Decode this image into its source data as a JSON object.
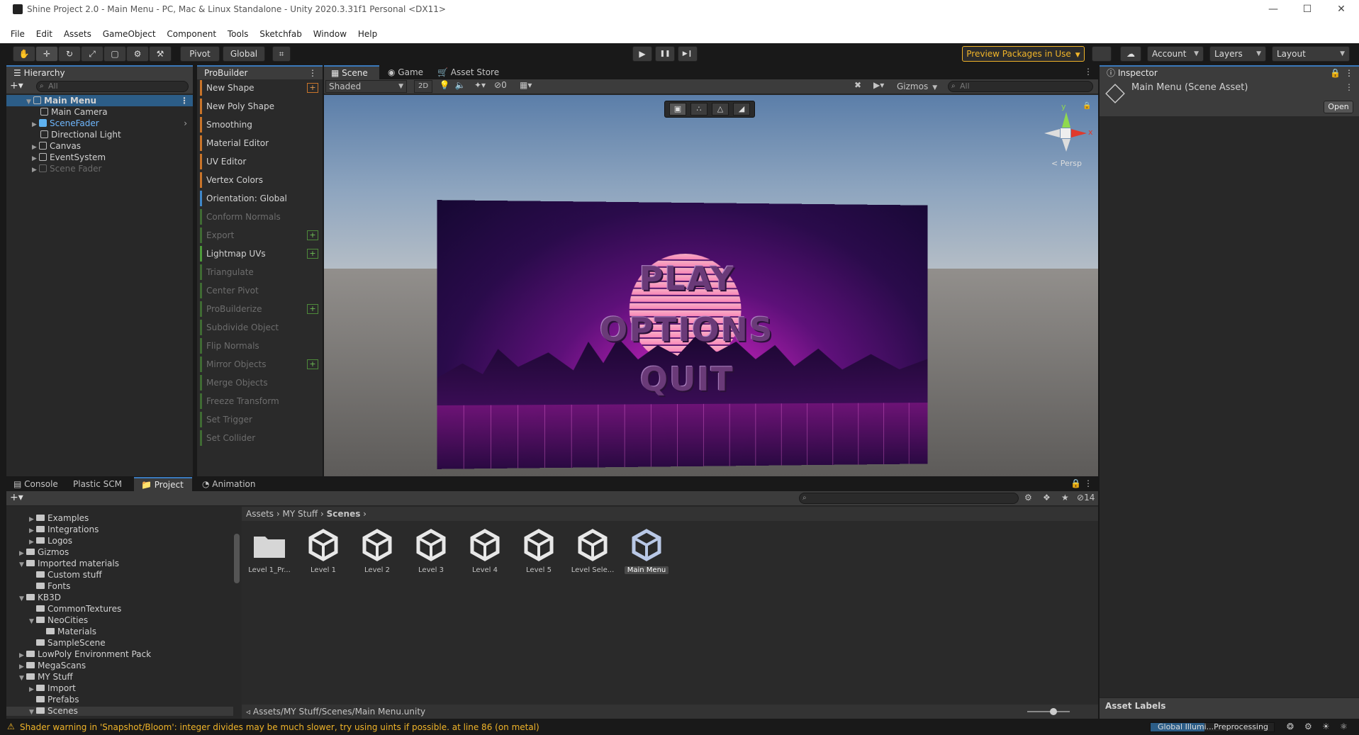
{
  "window": {
    "title": "Shine Project 2.0 - Main Menu - PC, Mac & Linux Standalone - Unity 2020.3.31f1 Personal <DX11>",
    "minimize": "—",
    "maximize": "☐",
    "close": "✕"
  },
  "menu": [
    "File",
    "Edit",
    "Assets",
    "GameObject",
    "Component",
    "Tools",
    "Sketchfab",
    "Window",
    "Help"
  ],
  "toolbar": {
    "tools": [
      "✋",
      "✛",
      "↻",
      "⤢",
      "▢",
      "⚙",
      "⚒"
    ],
    "pivot": "Pivot",
    "global": "Global",
    "snap": "⌗",
    "play": "▶",
    "pause": "❚❚",
    "step": "▶❙",
    "preview_packages": "Preview Packages in Use",
    "account": "Account",
    "layers": "Layers",
    "layout": "Layout",
    "colors": {
      "preview_packages": "#f0b429"
    }
  },
  "hierarchy": {
    "tab": "Hierarchy",
    "search_placeholder": "All",
    "scene": "Main Menu",
    "items": [
      {
        "label": "Main Camera"
      },
      {
        "label": "SceneFader"
      },
      {
        "label": "Directional Light"
      },
      {
        "label": "Canvas"
      },
      {
        "label": "EventSystem"
      },
      {
        "label": "Scene Fader"
      }
    ]
  },
  "probuilder": {
    "tab": "ProBuilder",
    "items": [
      {
        "label": "New Shape"
      },
      {
        "label": "New Poly Shape"
      },
      {
        "label": "Smoothing"
      },
      {
        "label": "Material Editor"
      },
      {
        "label": "UV Editor"
      },
      {
        "label": "Vertex Colors"
      },
      {
        "label": "Orientation: Global"
      },
      {
        "label": "Conform Normals"
      },
      {
        "label": "Export"
      },
      {
        "label": "Lightmap UVs"
      },
      {
        "label": "Triangulate"
      },
      {
        "label": "Center Pivot"
      },
      {
        "label": "ProBuilderize"
      },
      {
        "label": "Subdivide Object"
      },
      {
        "label": "Flip Normals"
      },
      {
        "label": "Mirror Objects"
      },
      {
        "label": "Merge Objects"
      },
      {
        "label": "Freeze Transform"
      },
      {
        "label": "Set Trigger"
      },
      {
        "label": "Set Collider"
      }
    ],
    "plus": "+"
  },
  "scene": {
    "tabs": [
      "Scene",
      "Game",
      "Asset Store"
    ],
    "shading": "Shaded",
    "mode_2d": "2D",
    "hidden_count": "0",
    "gizmos": "Gizmos",
    "search_placeholder": "All",
    "gizmo_y": "y",
    "gizmo_x": "x",
    "persp": "< Persp",
    "menu_play": "PLAY",
    "menu_options": "OPTIONS",
    "menu_quit": "QUIT"
  },
  "inspector": {
    "tab": "Inspector",
    "title": "Main Menu (Scene Asset)",
    "open": "Open",
    "asset_labels": "Asset Labels"
  },
  "bottom": {
    "tabs": [
      "Console",
      "Plastic SCM",
      "Project",
      "Animation"
    ],
    "hidden_count": "14",
    "breadcrumb": [
      "Assets",
      "MY Stuff",
      "Scenes"
    ],
    "path": "Assets/MY Stuff/Scenes/Main Menu.unity",
    "tree": [
      {
        "label": "Examples",
        "depth": 1,
        "arrow": true
      },
      {
        "label": "Integrations",
        "depth": 1,
        "arrow": true
      },
      {
        "label": "Logos",
        "depth": 1,
        "arrow": true
      },
      {
        "label": "Gizmos",
        "depth": 0,
        "arrow": true
      },
      {
        "label": "Imported materials",
        "depth": 0,
        "arrow": true,
        "open": true
      },
      {
        "label": "Custom stuff",
        "depth": 1,
        "arrow": false
      },
      {
        "label": "Fonts",
        "depth": 1,
        "arrow": false
      },
      {
        "label": "KB3D",
        "depth": 0,
        "arrow": true,
        "open": true
      },
      {
        "label": "CommonTextures",
        "depth": 1,
        "arrow": false
      },
      {
        "label": "NeoCities",
        "depth": 1,
        "arrow": true,
        "open": true
      },
      {
        "label": "Materials",
        "depth": 2,
        "arrow": false
      },
      {
        "label": "SampleScene",
        "depth": 1,
        "arrow": false
      },
      {
        "label": "LowPoly Environment Pack",
        "depth": 0,
        "arrow": true
      },
      {
        "label": "MegaScans",
        "depth": 0,
        "arrow": true
      },
      {
        "label": "MY Stuff",
        "depth": 0,
        "arrow": true,
        "open": true
      },
      {
        "label": "Import",
        "depth": 1,
        "arrow": true
      },
      {
        "label": "Prefabs",
        "depth": 1,
        "arrow": false
      },
      {
        "label": "Scenes",
        "depth": 1,
        "arrow": true,
        "open": true
      }
    ],
    "assets": [
      {
        "label": "Level 1_Pr...",
        "kind": "folder"
      },
      {
        "label": "Level 1",
        "kind": "scene"
      },
      {
        "label": "Level 2",
        "kind": "scene"
      },
      {
        "label": "Level 3",
        "kind": "scene"
      },
      {
        "label": "Level 4",
        "kind": "scene"
      },
      {
        "label": "Level 5",
        "kind": "scene"
      },
      {
        "label": "Level Sele...",
        "kind": "scene"
      },
      {
        "label": "Main Menu",
        "kind": "scene",
        "selected": true
      }
    ]
  },
  "status": {
    "warning": "Shader warning in 'Snapshot/Bloom': integer divides may be much slower, try using uints if possible. at line 86 (on metal)",
    "progress_label": "Global Illumi...Preprocessing",
    "colors": {
      "warning": "#f0b429",
      "progress": "#2c5d87"
    }
  }
}
